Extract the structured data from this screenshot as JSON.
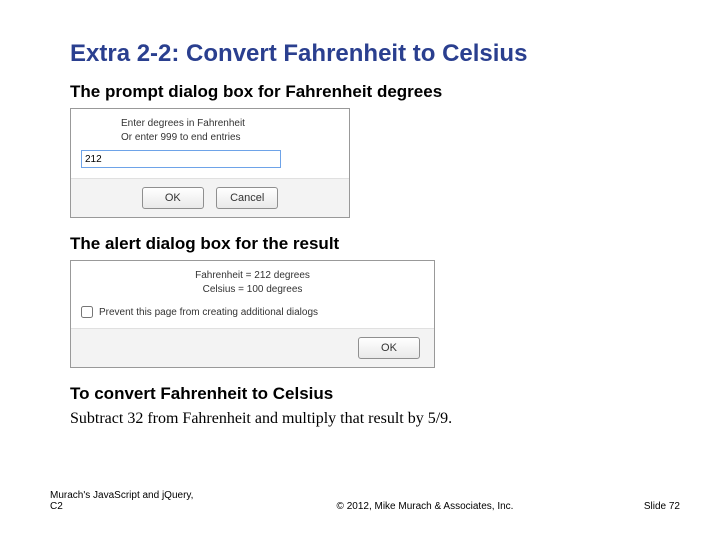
{
  "title": "Extra 2-2: Convert Fahrenheit to Celsius",
  "sections": {
    "prompt_heading": "The prompt dialog box for Fahrenheit degrees",
    "alert_heading": "The alert dialog box for the result",
    "convert_heading": "To convert Fahrenheit to Celsius",
    "convert_text": "Subtract 32 from Fahrenheit and multiply that result by 5/9."
  },
  "prompt_dialog": {
    "line1": "Enter degrees in Fahrenheit",
    "line2": "Or enter 999 to end entries",
    "input_value": "212",
    "ok": "OK",
    "cancel": "Cancel"
  },
  "alert_dialog": {
    "line1": "Fahrenheit = 212 degrees",
    "line2": "Celsius = 100 degrees",
    "checkbox_label": "Prevent this page from creating additional dialogs",
    "ok": "OK"
  },
  "footer": {
    "left_line1": "Murach's JavaScript and jQuery,",
    "left_line2": "C2",
    "center": "© 2012, Mike Murach & Associates, Inc.",
    "right": "Slide 72"
  }
}
